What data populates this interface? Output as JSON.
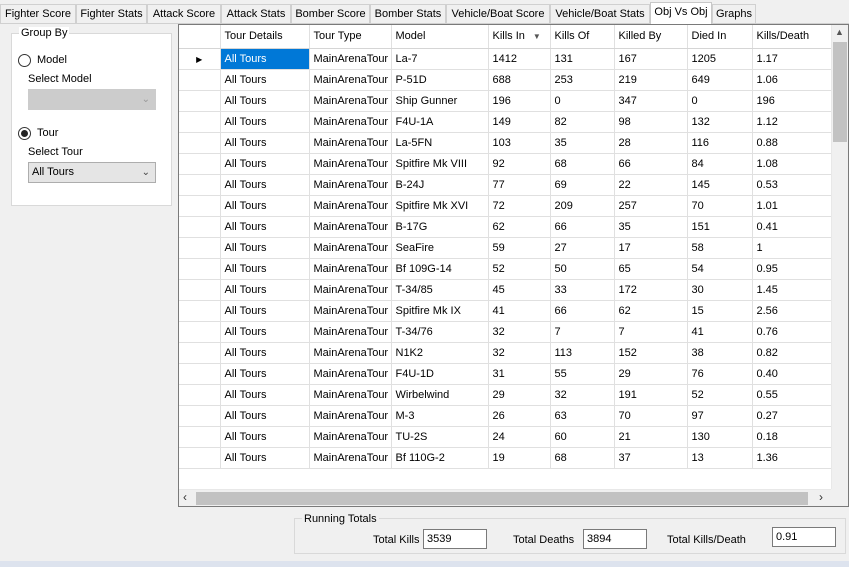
{
  "tabs": [
    "Fighter Score",
    "Fighter Stats",
    "Attack Score",
    "Attack Stats",
    "Bomber Score",
    "Bomber Stats",
    "Vehicle/Boat Score",
    "Vehicle/Boat Stats",
    "Obj Vs Obj",
    "Graphs"
  ],
  "active_tab": "Obj Vs Obj",
  "group_by": {
    "title": "Group By",
    "model_option": "Model",
    "select_model_label": "Select Model",
    "model_value": "",
    "tour_option": "Tour",
    "select_tour_label": "Select Tour",
    "tour_value": "All Tours",
    "selected": "Tour"
  },
  "grid": {
    "columns": [
      "Tour Details",
      "Tour Type",
      "Model",
      "Kills In",
      "Kills Of",
      "Killed By",
      "Died In",
      "Kills/Death"
    ],
    "sorted_column": "Kills In",
    "sort_direction": "descending",
    "rows": [
      [
        "All Tours",
        "MainArenaTour",
        "La-7",
        "1412",
        "131",
        "167",
        "1205",
        "1.17"
      ],
      [
        "All Tours",
        "MainArenaTour",
        "P-51D",
        "688",
        "253",
        "219",
        "649",
        "1.06"
      ],
      [
        "All Tours",
        "MainArenaTour",
        "Ship Gunner",
        "196",
        "0",
        "347",
        "0",
        "196"
      ],
      [
        "All Tours",
        "MainArenaTour",
        "F4U-1A",
        "149",
        "82",
        "98",
        "132",
        "1.12"
      ],
      [
        "All Tours",
        "MainArenaTour",
        "La-5FN",
        "103",
        "35",
        "28",
        "116",
        "0.88"
      ],
      [
        "All Tours",
        "MainArenaTour",
        "Spitfire Mk VIII",
        "92",
        "68",
        "66",
        "84",
        "1.08"
      ],
      [
        "All Tours",
        "MainArenaTour",
        "B-24J",
        "77",
        "69",
        "22",
        "145",
        "0.53"
      ],
      [
        "All Tours",
        "MainArenaTour",
        "Spitfire Mk XVI",
        "72",
        "209",
        "257",
        "70",
        "1.01"
      ],
      [
        "All Tours",
        "MainArenaTour",
        "B-17G",
        "62",
        "66",
        "35",
        "151",
        "0.41"
      ],
      [
        "All Tours",
        "MainArenaTour",
        "SeaFire",
        "59",
        "27",
        "17",
        "58",
        "1"
      ],
      [
        "All Tours",
        "MainArenaTour",
        "Bf 109G-14",
        "52",
        "50",
        "65",
        "54",
        "0.95"
      ],
      [
        "All Tours",
        "MainArenaTour",
        "T-34/85",
        "45",
        "33",
        "172",
        "30",
        "1.45"
      ],
      [
        "All Tours",
        "MainArenaTour",
        "Spitfire Mk IX",
        "41",
        "66",
        "62",
        "15",
        "2.56"
      ],
      [
        "All Tours",
        "MainArenaTour",
        "T-34/76",
        "32",
        "7",
        "7",
        "41",
        "0.76"
      ],
      [
        "All Tours",
        "MainArenaTour",
        "N1K2",
        "32",
        "113",
        "152",
        "38",
        "0.82"
      ],
      [
        "All Tours",
        "MainArenaTour",
        "F4U-1D",
        "31",
        "55",
        "29",
        "76",
        "0.40"
      ],
      [
        "All Tours",
        "MainArenaTour",
        "Wirbelwind",
        "29",
        "32",
        "191",
        "52",
        "0.55"
      ],
      [
        "All Tours",
        "MainArenaTour",
        "M-3",
        "26",
        "63",
        "70",
        "97",
        "0.27"
      ],
      [
        "All Tours",
        "MainArenaTour",
        "TU-2S",
        "24",
        "60",
        "21",
        "130",
        "0.18"
      ],
      [
        "All Tours",
        "MainArenaTour",
        "Bf 110G-2",
        "19",
        "68",
        "37",
        "13",
        "1.36"
      ]
    ],
    "selected_row": 0,
    "selected_col": 0
  },
  "totals": {
    "title": "Running Totals",
    "kills_label": "Total Kills",
    "kills_value": "3539",
    "deaths_label": "Total Deaths",
    "deaths_value": "3894",
    "kd_label": "Total Kills/Death",
    "kd_value": "0.91"
  },
  "colors": {
    "selection": "#0078d7",
    "window": "#f0f0f0"
  }
}
